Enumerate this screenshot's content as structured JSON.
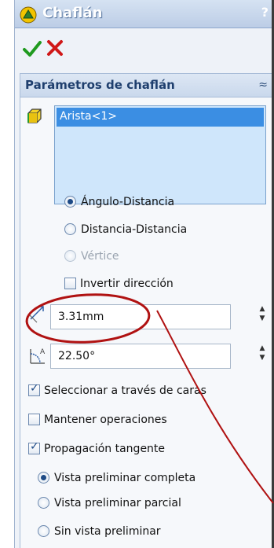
{
  "window": {
    "title": "Chaflán",
    "help_label": "?"
  },
  "actions": {
    "ok_icon": "green-check-icon",
    "cancel_icon": "red-x-icon"
  },
  "params": {
    "header": "Parámetros de chaflán",
    "selection": {
      "items": [
        "Arista<1>"
      ]
    },
    "chamfer_type": [
      {
        "label": "Ángulo-Distancia",
        "selected": true,
        "enabled": true
      },
      {
        "label": "Distancia-Distancia",
        "selected": false,
        "enabled": true
      },
      {
        "label": "Vértice",
        "selected": false,
        "enabled": false
      }
    ],
    "reverse_direction": {
      "label": "Invertir dirección",
      "checked": false
    },
    "distance": {
      "value": "3.31mm"
    },
    "angle": {
      "value": "22.50°"
    },
    "select_through_faces": {
      "label": "Seleccionar a través de caras",
      "checked": true
    },
    "keep_features": {
      "label": "Mantener operaciones",
      "checked": false
    },
    "tangent_propagation": {
      "label": "Propagación tangente",
      "checked": true
    },
    "preview": [
      {
        "label": "Vista preliminar completa",
        "selected": true
      },
      {
        "label": "Vista preliminar parcial",
        "selected": false
      },
      {
        "label": "Sin vista preliminar",
        "selected": false
      }
    ]
  },
  "colors": {
    "accent": "#3b8ee3",
    "annotation": "#b01212",
    "ok": "#1f9a1f",
    "cancel": "#d01818"
  }
}
